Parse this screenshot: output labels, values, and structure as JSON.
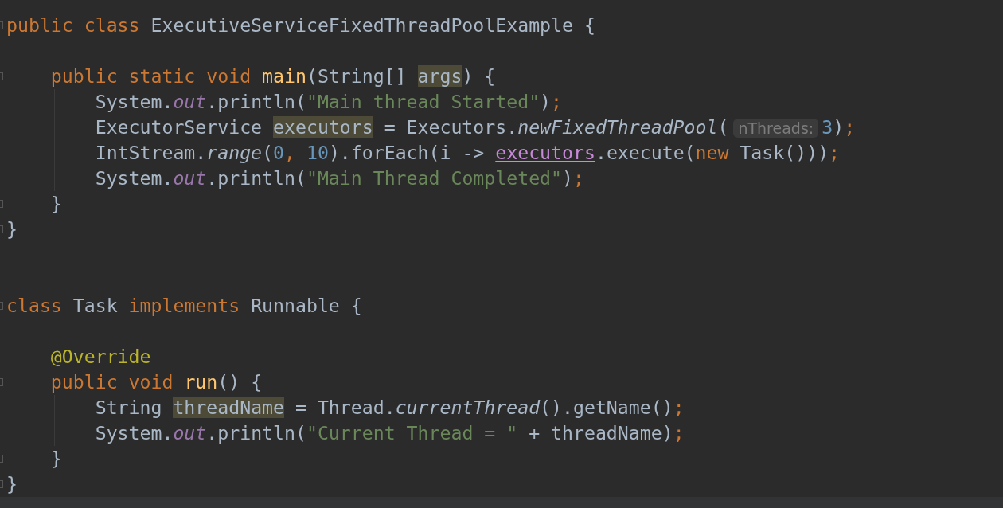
{
  "editor": {
    "lines": [
      {
        "kind": "code",
        "fold_marker": true,
        "guide": false,
        "tokens": [
          {
            "kind": "keyword",
            "text": "public class "
          },
          {
            "kind": "plain",
            "text": "ExecutiveServiceFixedThreadPoolExample {"
          }
        ]
      },
      {
        "kind": "blank",
        "fold_marker": false,
        "guide": false
      },
      {
        "kind": "code",
        "fold_marker": true,
        "guide": false,
        "tokens": [
          {
            "kind": "keyword",
            "text": "    public static void "
          },
          {
            "kind": "decl",
            "text": "main"
          },
          {
            "kind": "plain",
            "text": "(String[] "
          },
          {
            "kind": "usage",
            "text": "args"
          },
          {
            "kind": "plain",
            "text": ") {"
          }
        ]
      },
      {
        "kind": "code",
        "fold_marker": false,
        "guide": true,
        "tokens": [
          {
            "kind": "plain",
            "text": "        System."
          },
          {
            "kind": "field",
            "text": "out"
          },
          {
            "kind": "plain",
            "text": ".println("
          },
          {
            "kind": "string",
            "text": "\"Main thread Started\""
          },
          {
            "kind": "plain",
            "text": ")"
          },
          {
            "kind": "keyword",
            "text": ";"
          }
        ]
      },
      {
        "kind": "code",
        "fold_marker": false,
        "guide": true,
        "tokens": [
          {
            "kind": "plain",
            "text": "        ExecutorService "
          },
          {
            "kind": "usage",
            "text": "executors"
          },
          {
            "kind": "plain",
            "text": " = Executors."
          },
          {
            "kind": "call",
            "text": "newFixedThreadPool"
          },
          {
            "kind": "plain",
            "text": "("
          },
          {
            "kind": "hint",
            "text": "nThreads:"
          },
          {
            "kind": "number",
            "text": "3"
          },
          {
            "kind": "plain",
            "text": ")"
          },
          {
            "kind": "keyword",
            "text": ";"
          }
        ]
      },
      {
        "kind": "code",
        "fold_marker": false,
        "guide": true,
        "tokens": [
          {
            "kind": "plain",
            "text": "        IntStream."
          },
          {
            "kind": "call",
            "text": "range"
          },
          {
            "kind": "plain",
            "text": "("
          },
          {
            "kind": "number",
            "text": "0"
          },
          {
            "kind": "keyword",
            "text": ", "
          },
          {
            "kind": "number",
            "text": "10"
          },
          {
            "kind": "plain",
            "text": ").forEach(i -> "
          },
          {
            "kind": "link",
            "text": "executors"
          },
          {
            "kind": "plain",
            "text": ".execute("
          },
          {
            "kind": "keyword",
            "text": "new "
          },
          {
            "kind": "plain",
            "text": "Task()))"
          },
          {
            "kind": "keyword",
            "text": ";"
          }
        ]
      },
      {
        "kind": "code",
        "fold_marker": false,
        "guide": true,
        "tokens": [
          {
            "kind": "plain",
            "text": "        System."
          },
          {
            "kind": "field",
            "text": "out"
          },
          {
            "kind": "plain",
            "text": ".println("
          },
          {
            "kind": "string",
            "text": "\"Main Thread Completed\""
          },
          {
            "kind": "plain",
            "text": ")"
          },
          {
            "kind": "keyword",
            "text": ";"
          }
        ]
      },
      {
        "kind": "code",
        "fold_marker": true,
        "guide": false,
        "tokens": [
          {
            "kind": "plain",
            "text": "    }"
          }
        ]
      },
      {
        "kind": "code",
        "fold_marker": true,
        "guide": false,
        "tokens": [
          {
            "kind": "plain",
            "text": "}"
          }
        ]
      },
      {
        "kind": "blank",
        "fold_marker": false,
        "guide": false
      },
      {
        "kind": "blank",
        "fold_marker": false,
        "guide": false
      },
      {
        "kind": "code",
        "fold_marker": true,
        "guide": false,
        "tokens": [
          {
            "kind": "keyword",
            "text": "class "
          },
          {
            "kind": "plain",
            "text": "Task "
          },
          {
            "kind": "keyword",
            "text": "implements "
          },
          {
            "kind": "plain",
            "text": "Runnable {"
          }
        ]
      },
      {
        "kind": "blank",
        "fold_marker": false,
        "guide": false
      },
      {
        "kind": "code",
        "fold_marker": false,
        "guide": false,
        "tokens": [
          {
            "kind": "annotation",
            "text": "    @Override"
          }
        ]
      },
      {
        "kind": "code",
        "fold_marker": true,
        "guide": false,
        "tokens": [
          {
            "kind": "keyword",
            "text": "    public void "
          },
          {
            "kind": "decl",
            "text": "run"
          },
          {
            "kind": "plain",
            "text": "() {"
          }
        ]
      },
      {
        "kind": "code",
        "fold_marker": false,
        "guide": true,
        "tokens": [
          {
            "kind": "plain",
            "text": "        String "
          },
          {
            "kind": "usage",
            "text": "threadName"
          },
          {
            "kind": "plain",
            "text": " = Thread."
          },
          {
            "kind": "call",
            "text": "currentThread"
          },
          {
            "kind": "plain",
            "text": "().getName()"
          },
          {
            "kind": "keyword",
            "text": ";"
          }
        ]
      },
      {
        "kind": "code",
        "fold_marker": false,
        "guide": true,
        "tokens": [
          {
            "kind": "plain",
            "text": "        System."
          },
          {
            "kind": "field",
            "text": "out"
          },
          {
            "kind": "plain",
            "text": ".println("
          },
          {
            "kind": "string",
            "text": "\"Current Thread = \""
          },
          {
            "kind": "plain",
            "text": " + threadName)"
          },
          {
            "kind": "keyword",
            "text": ";"
          }
        ]
      },
      {
        "kind": "code",
        "fold_marker": true,
        "guide": false,
        "tokens": [
          {
            "kind": "plain",
            "text": "    }"
          }
        ]
      },
      {
        "kind": "code",
        "fold_marker": true,
        "guide": false,
        "tokens": [
          {
            "kind": "plain",
            "text": "}"
          }
        ]
      }
    ]
  }
}
